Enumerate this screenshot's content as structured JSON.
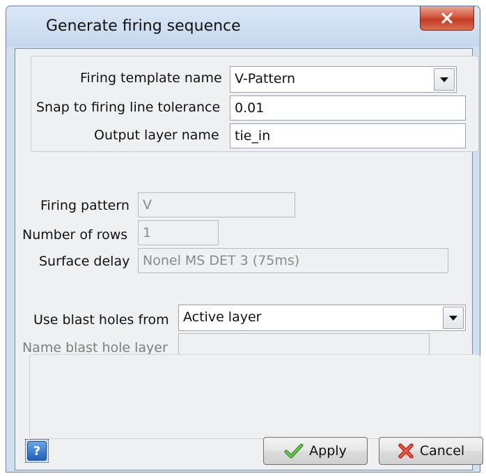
{
  "window": {
    "title": "Generate firing sequence"
  },
  "template_group": {
    "firing_template_name": {
      "label": "Firing template name",
      "value": "V-Pattern"
    },
    "snap_tolerance": {
      "label": "Snap to firing line tolerance",
      "value": "0.01"
    },
    "output_layer": {
      "label": "Output layer name",
      "value": "tie_in"
    }
  },
  "pattern_info": {
    "firing_pattern": {
      "label": "Firing pattern",
      "value": "V"
    },
    "number_of_rows": {
      "label": "Number of rows",
      "value": "1"
    },
    "surface_delay": {
      "label": "Surface delay",
      "value": "Nonel MS DET 3 (75ms)"
    }
  },
  "blast_holes": {
    "use_from": {
      "label": "Use blast holes from",
      "value": "Active layer"
    },
    "layer_name": {
      "label": "Name blast hole layer",
      "value": ""
    }
  },
  "footer": {
    "help_label": "?",
    "apply_label": "Apply",
    "cancel_label": "Cancel"
  },
  "icons": {
    "close": "close-icon",
    "help": "help-icon",
    "apply": "checkmark-icon",
    "cancel": "cross-icon",
    "dropdown": "chevron-down-icon"
  },
  "colors": {
    "close_button": "#c94a30",
    "apply_check": "#3a9d2a",
    "cancel_cross": "#d93a2a",
    "help_button": "#2a6fd0"
  }
}
